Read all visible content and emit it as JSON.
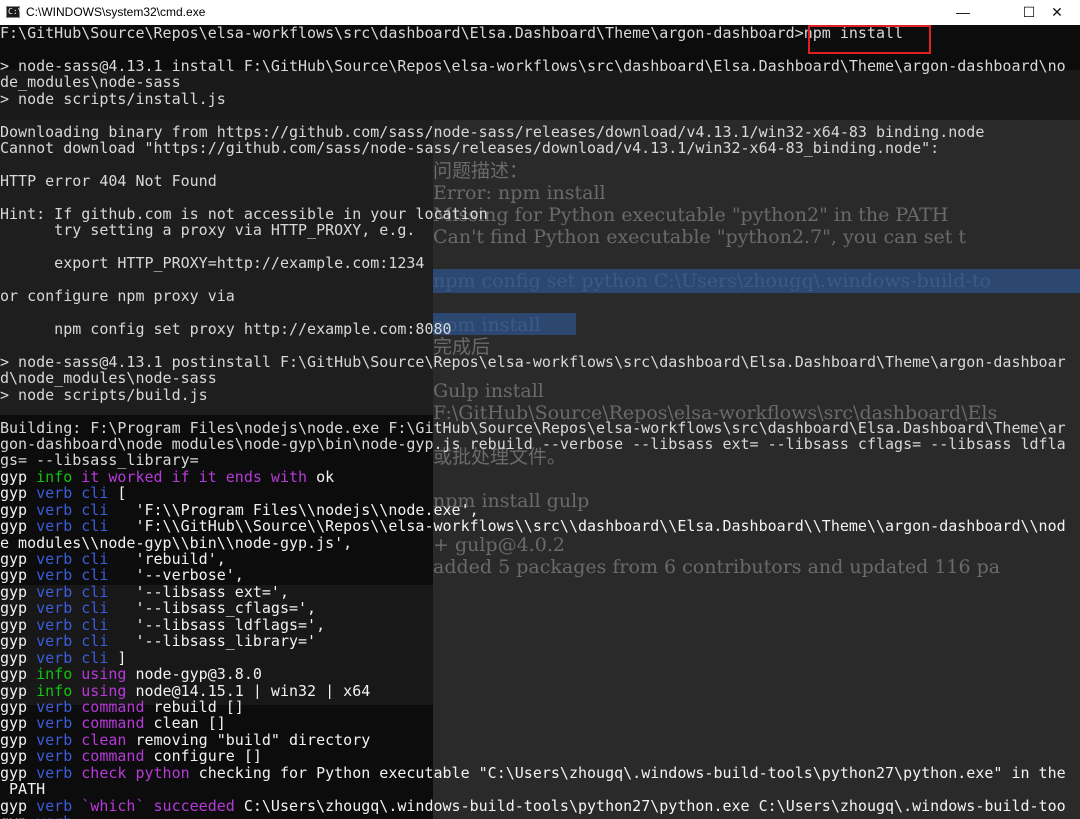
{
  "window": {
    "title": "C:\\WINDOWS\\system32\\cmd.exe",
    "icon": "console-app-icon",
    "icon_glyph": "C:\\",
    "minimize_glyph": "—",
    "maximize_glyph": "☐",
    "close_glyph": "✕"
  },
  "highlight": {
    "color": "#e02020",
    "target": "npm install"
  },
  "background_overlay": {
    "lines": [
      "问题描述：",
      "Error: npm install",
      "Missing for Python executable \"python2\" in the PATH",
      "Can't find Python executable \"python2.7\", you can set t",
      "npm config set python C:\\Users\\zhougq\\.windows-build-to",
      "npm install",
      "完成后",
      "Gulp install",
      "F:\\GitHub\\Source\\Repos\\elsa-workflows\\src\\dashboard\\Els",
      "或批处理文件。",
      "npm install gulp",
      "+ gulp@4.0.2",
      "added 5 packages from 6 contributors and updated 116 pa"
    ]
  },
  "console": {
    "lines": [
      [
        {
          "t": "F:\\GitHub\\Source\\Repos\\elsa-workflows\\src\\dashboard\\Elsa.Dashboard\\Theme\\argon-dashboard>npm install",
          "c": "gray"
        }
      ],
      [
        {
          "t": "",
          "c": "gray"
        }
      ],
      [
        {
          "t": "> node-sass@4.13.1 install F:\\GitHub\\Source\\Repos\\elsa-workflows\\src\\dashboard\\Elsa.Dashboard\\Theme\\argon-dashboard\\no",
          "c": "gray"
        }
      ],
      [
        {
          "t": "de_modules\\node-sass",
          "c": "gray"
        }
      ],
      [
        {
          "t": "> node scripts/install.js",
          "c": "gray"
        }
      ],
      [
        {
          "t": "",
          "c": "gray"
        }
      ],
      [
        {
          "t": "Downloading binary from https://github.com/sass/node-sass/releases/download/v4.13.1/win32-x64-83_binding.node",
          "c": "gray"
        }
      ],
      [
        {
          "t": "Cannot download \"https://github.com/sass/node-sass/releases/download/v4.13.1/win32-x64-83_binding.node\":",
          "c": "gray"
        }
      ],
      [
        {
          "t": "",
          "c": "gray"
        }
      ],
      [
        {
          "t": "HTTP error 404 Not Found",
          "c": "gray"
        }
      ],
      [
        {
          "t": "",
          "c": "gray"
        }
      ],
      [
        {
          "t": "Hint: If github.com is not accessible in your location",
          "c": "gray"
        }
      ],
      [
        {
          "t": "      try setting a proxy via HTTP_PROXY, e.g.",
          "c": "gray"
        }
      ],
      [
        {
          "t": "",
          "c": "gray"
        }
      ],
      [
        {
          "t": "      export HTTP_PROXY=http://example.com:1234",
          "c": "gray"
        }
      ],
      [
        {
          "t": "",
          "c": "gray"
        }
      ],
      [
        {
          "t": "or configure npm proxy via",
          "c": "gray"
        }
      ],
      [
        {
          "t": "",
          "c": "gray"
        }
      ],
      [
        {
          "t": "      npm config set proxy http://example.com:8080",
          "c": "gray"
        }
      ],
      [
        {
          "t": "",
          "c": "gray"
        }
      ],
      [
        {
          "t": "> node-sass@4.13.1 postinstall F:\\GitHub\\Source\\Repos\\elsa-workflows\\src\\dashboard\\Elsa.Dashboard\\Theme\\argon-dashboar",
          "c": "gray"
        }
      ],
      [
        {
          "t": "d\\node_modules\\node-sass",
          "c": "gray"
        }
      ],
      [
        {
          "t": "> node scripts/build.js",
          "c": "gray"
        }
      ],
      [
        {
          "t": "",
          "c": "gray"
        }
      ],
      [
        {
          "t": "Building: F:\\Program Files\\nodejs\\node.exe F:\\GitHub\\Source\\Repos\\elsa-workflows\\src\\dashboard\\Elsa.Dashboard\\Theme\\ar",
          "c": "gray"
        }
      ],
      [
        {
          "t": "gon-dashboard\\node_modules\\node-gyp\\bin\\node-gyp.js rebuild --verbose --libsass_ext= --libsass_cflags= --libsass_ldfla",
          "c": "gray"
        }
      ],
      [
        {
          "t": "gs= --libsass_library=",
          "c": "gray"
        }
      ],
      [
        {
          "t": "gyp ",
          "c": "white"
        },
        {
          "t": "info",
          "c": "green"
        },
        {
          "t": " it worked if it ends with ",
          "c": "magenta"
        },
        {
          "t": "ok",
          "c": "white"
        }
      ],
      [
        {
          "t": "gyp ",
          "c": "white"
        },
        {
          "t": "verb",
          "c": "blue"
        },
        {
          "t": " cli",
          "c": "blue"
        },
        {
          "t": " [",
          "c": "white"
        }
      ],
      [
        {
          "t": "gyp ",
          "c": "white"
        },
        {
          "t": "verb",
          "c": "blue"
        },
        {
          "t": " cli",
          "c": "blue"
        },
        {
          "t": "   'F:\\\\Program Files\\\\nodejs\\\\node.exe',",
          "c": "white"
        }
      ],
      [
        {
          "t": "gyp ",
          "c": "white"
        },
        {
          "t": "verb",
          "c": "blue"
        },
        {
          "t": " cli",
          "c": "blue"
        },
        {
          "t": "   'F:\\\\GitHub\\\\Source\\\\Repos\\\\elsa-workflows\\\\src\\\\dashboard\\\\Elsa.Dashboard\\\\Theme\\\\argon-dashboard\\\\nod",
          "c": "white"
        }
      ],
      [
        {
          "t": "e_modules\\\\node-gyp\\\\bin\\\\node-gyp.js',",
          "c": "white"
        }
      ],
      [
        {
          "t": "gyp ",
          "c": "white"
        },
        {
          "t": "verb",
          "c": "blue"
        },
        {
          "t": " cli",
          "c": "blue"
        },
        {
          "t": "   'rebuild',",
          "c": "white"
        }
      ],
      [
        {
          "t": "gyp ",
          "c": "white"
        },
        {
          "t": "verb",
          "c": "blue"
        },
        {
          "t": " cli",
          "c": "blue"
        },
        {
          "t": "   '--verbose',",
          "c": "white"
        }
      ],
      [
        {
          "t": "gyp ",
          "c": "white"
        },
        {
          "t": "verb",
          "c": "blue"
        },
        {
          "t": " cli",
          "c": "blue"
        },
        {
          "t": "   '--libsass_ext=',",
          "c": "white"
        }
      ],
      [
        {
          "t": "gyp ",
          "c": "white"
        },
        {
          "t": "verb",
          "c": "blue"
        },
        {
          "t": " cli",
          "c": "blue"
        },
        {
          "t": "   '--libsass_cflags=',",
          "c": "white"
        }
      ],
      [
        {
          "t": "gyp ",
          "c": "white"
        },
        {
          "t": "verb",
          "c": "blue"
        },
        {
          "t": " cli",
          "c": "blue"
        },
        {
          "t": "   '--libsass_ldflags=',",
          "c": "white"
        }
      ],
      [
        {
          "t": "gyp ",
          "c": "white"
        },
        {
          "t": "verb",
          "c": "blue"
        },
        {
          "t": " cli",
          "c": "blue"
        },
        {
          "t": "   '--libsass_library='",
          "c": "white"
        }
      ],
      [
        {
          "t": "gyp ",
          "c": "white"
        },
        {
          "t": "verb",
          "c": "blue"
        },
        {
          "t": " cli",
          "c": "blue"
        },
        {
          "t": " ]",
          "c": "white"
        }
      ],
      [
        {
          "t": "gyp ",
          "c": "white"
        },
        {
          "t": "info",
          "c": "green"
        },
        {
          "t": " using",
          "c": "magenta"
        },
        {
          "t": " node-gyp@3.8.0",
          "c": "white"
        }
      ],
      [
        {
          "t": "gyp ",
          "c": "white"
        },
        {
          "t": "info",
          "c": "green"
        },
        {
          "t": " using",
          "c": "magenta"
        },
        {
          "t": " node@14.15.1 | win32 | x64",
          "c": "white"
        }
      ],
      [
        {
          "t": "gyp ",
          "c": "white"
        },
        {
          "t": "verb",
          "c": "blue"
        },
        {
          "t": " command",
          "c": "magenta"
        },
        {
          "t": " rebuild []",
          "c": "white"
        }
      ],
      [
        {
          "t": "gyp ",
          "c": "white"
        },
        {
          "t": "verb",
          "c": "blue"
        },
        {
          "t": " command",
          "c": "magenta"
        },
        {
          "t": " clean []",
          "c": "white"
        }
      ],
      [
        {
          "t": "gyp ",
          "c": "white"
        },
        {
          "t": "verb",
          "c": "blue"
        },
        {
          "t": " clean",
          "c": "magenta"
        },
        {
          "t": " removing \"build\" directory",
          "c": "white"
        }
      ],
      [
        {
          "t": "gyp ",
          "c": "white"
        },
        {
          "t": "verb",
          "c": "blue"
        },
        {
          "t": " command",
          "c": "magenta"
        },
        {
          "t": " configure []",
          "c": "white"
        }
      ],
      [
        {
          "t": "gyp ",
          "c": "white"
        },
        {
          "t": "verb",
          "c": "blue"
        },
        {
          "t": " check python",
          "c": "magenta"
        },
        {
          "t": " checking for Python executable \"C:\\Users\\zhougq\\.windows-build-tools\\python27\\python.exe\" in the",
          "c": "white"
        }
      ],
      [
        {
          "t": " PATH",
          "c": "white"
        }
      ],
      [
        {
          "t": "gyp ",
          "c": "white"
        },
        {
          "t": "verb",
          "c": "blue"
        },
        {
          "t": " `which` succeeded",
          "c": "magenta"
        },
        {
          "t": " C:\\Users\\zhougq\\.windows-build-tools\\python27\\python.exe C:\\Users\\zhougq\\.windows-build-too",
          "c": "white"
        }
      ],
      [
        {
          "t": "gyp ",
          "c": "white"
        },
        {
          "t": "verb",
          "c": "blue"
        },
        {
          "t": " ",
          "c": "white"
        }
      ]
    ]
  },
  "colors": {
    "background": "#0c0c0c",
    "text": "#d8d8d8",
    "green": "#13c40e",
    "blue": "#3b5dd8",
    "magenta": "#b63ad8"
  }
}
